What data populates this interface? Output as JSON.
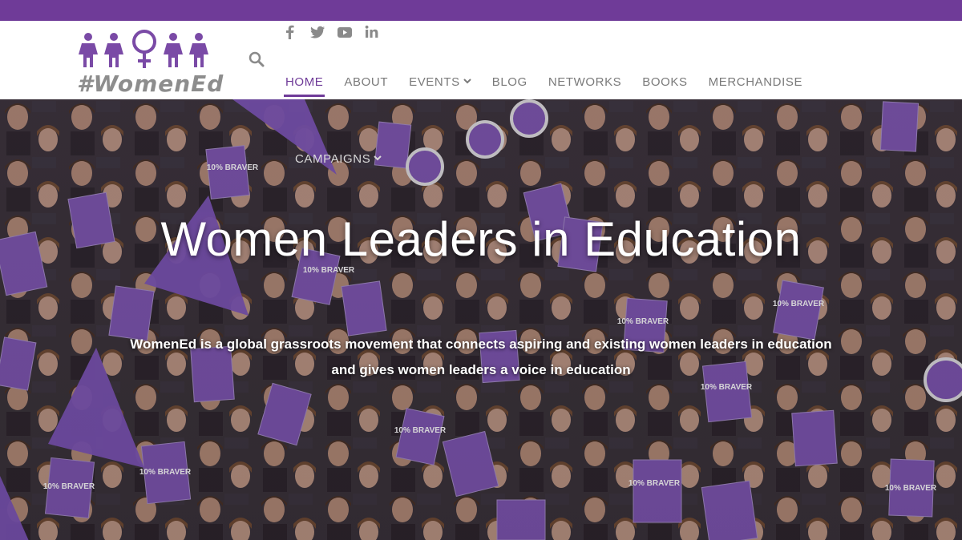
{
  "brand": {
    "logo_text": "#WomenEd",
    "accent": "#6f3b98"
  },
  "social": [
    {
      "icon": "facebook-icon"
    },
    {
      "icon": "twitter-icon"
    },
    {
      "icon": "youtube-icon"
    },
    {
      "icon": "linkedin-icon"
    }
  ],
  "nav": {
    "home": "HOME",
    "about": "ABOUT",
    "events": "EVENTS",
    "blog": "BLOG",
    "networks": "NETWORKS",
    "books": "BOOKS",
    "merchandise": "MERCHANDISE",
    "campaigns": "CAMPAIGNS"
  },
  "hero": {
    "title": "Women Leaders in Education",
    "subtitle_line1": "WomenEd is a global grassroots movement that connects aspiring and existing women leaders in education",
    "subtitle_line2": "and gives women leaders a voice in education",
    "book_label": "10% BRAVER"
  }
}
